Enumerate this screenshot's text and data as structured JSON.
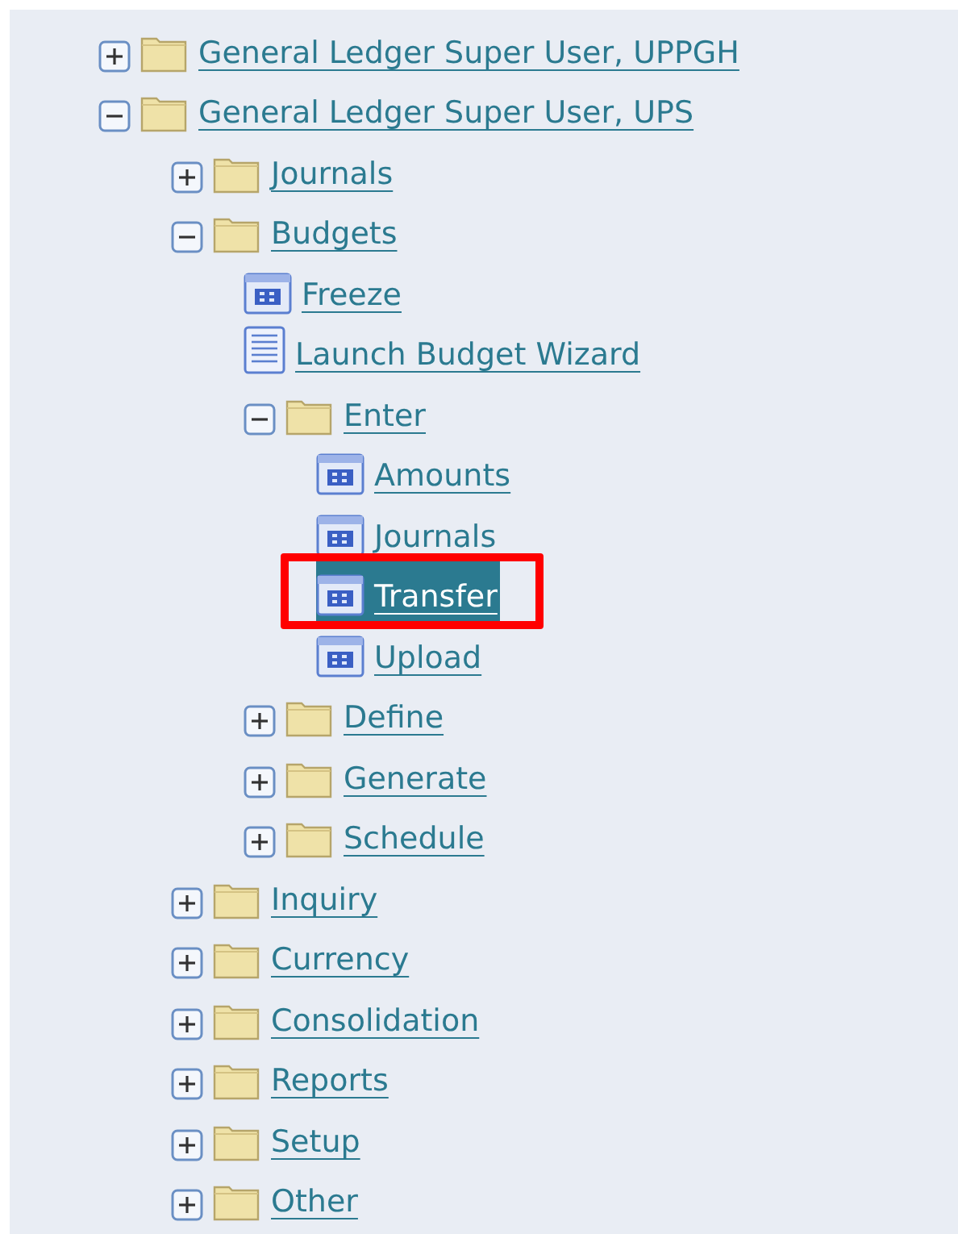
{
  "tree": [
    {
      "kind": "folder",
      "label": "General Ledger Super User, UPPGH",
      "expanded": false,
      "selected": false
    },
    {
      "kind": "folder",
      "label": "General Ledger Super User, UPS",
      "expanded": true,
      "selected": false,
      "children": [
        {
          "kind": "folder",
          "label": "Journals",
          "expanded": false,
          "selected": false
        },
        {
          "kind": "folder",
          "label": "Budgets",
          "expanded": true,
          "selected": false,
          "children": [
            {
              "kind": "form",
              "label": "Freeze",
              "selected": false
            },
            {
              "kind": "document",
              "label": "Launch Budget Wizard",
              "selected": false
            },
            {
              "kind": "folder",
              "label": "Enter",
              "expanded": true,
              "selected": false,
              "children": [
                {
                  "kind": "form",
                  "label": "Amounts",
                  "selected": false
                },
                {
                  "kind": "form",
                  "label": "Journals",
                  "selected": false
                },
                {
                  "kind": "form",
                  "label": "Transfer",
                  "selected": true,
                  "outlined": true
                },
                {
                  "kind": "form",
                  "label": "Upload",
                  "selected": false
                }
              ]
            },
            {
              "kind": "folder",
              "label": "Define",
              "expanded": false,
              "selected": false
            },
            {
              "kind": "folder",
              "label": "Generate",
              "expanded": false,
              "selected": false
            },
            {
              "kind": "folder",
              "label": "Schedule",
              "expanded": false,
              "selected": false
            }
          ]
        },
        {
          "kind": "folder",
          "label": "Inquiry",
          "expanded": false,
          "selected": false
        },
        {
          "kind": "folder",
          "label": "Currency",
          "expanded": false,
          "selected": false
        },
        {
          "kind": "folder",
          "label": "Consolidation",
          "expanded": false,
          "selected": false
        },
        {
          "kind": "folder",
          "label": "Reports",
          "expanded": false,
          "selected": false
        },
        {
          "kind": "folder",
          "label": "Setup",
          "expanded": false,
          "selected": false
        },
        {
          "kind": "folder",
          "label": "Other",
          "expanded": false,
          "selected": false
        }
      ]
    }
  ]
}
